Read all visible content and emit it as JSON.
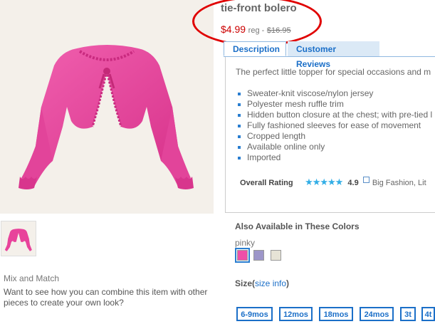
{
  "product": {
    "title": "tie-front bolero",
    "price": "$4.99",
    "reg_label": "reg -",
    "was_price": "$16.95",
    "image_alt": "pink tie-front bolero cardigan"
  },
  "tabs": [
    {
      "label": "Description",
      "active": true
    },
    {
      "label": "Customer Reviews",
      "active": false
    }
  ],
  "description": {
    "intro": "The perfect little topper for special occasions and m",
    "features": [
      "Sweater-knit viscose/nylon jersey",
      "Polyester mesh ruffle trim",
      "Hidden button closure at the chest; with pre-tied l",
      "Fully fashioned sleeves for ease of movement",
      "Cropped length",
      "Available online only",
      "Imported"
    ]
  },
  "rating": {
    "label": "Overall Rating",
    "stars": "★★★★★",
    "value": "4.9",
    "source": "Big Fashion, Lit"
  },
  "colors": {
    "title": "Also Available in These Colors",
    "selected_name": "pinky",
    "swatches": [
      {
        "name": "pinky",
        "color": "#ee4fa8",
        "selected": true
      },
      {
        "name": "lavender",
        "color": "#9d96c9",
        "selected": false
      },
      {
        "name": "cream",
        "color": "#e6e3d6",
        "selected": false
      }
    ]
  },
  "size": {
    "label": "Size(",
    "link": "size info",
    "close": ")",
    "options": [
      "6-9mos",
      "12mos",
      "18mos",
      "24mos",
      "3t",
      "4t"
    ]
  },
  "mix": {
    "title": "Mix and Match",
    "text": "Want to see how you can combine this item with other pieces to create your own look?"
  },
  "theme": {
    "accent": "#1b6fc8",
    "price_red": "#cc0000",
    "garment": "#e8439b",
    "highlight_circle": "#e00000"
  }
}
